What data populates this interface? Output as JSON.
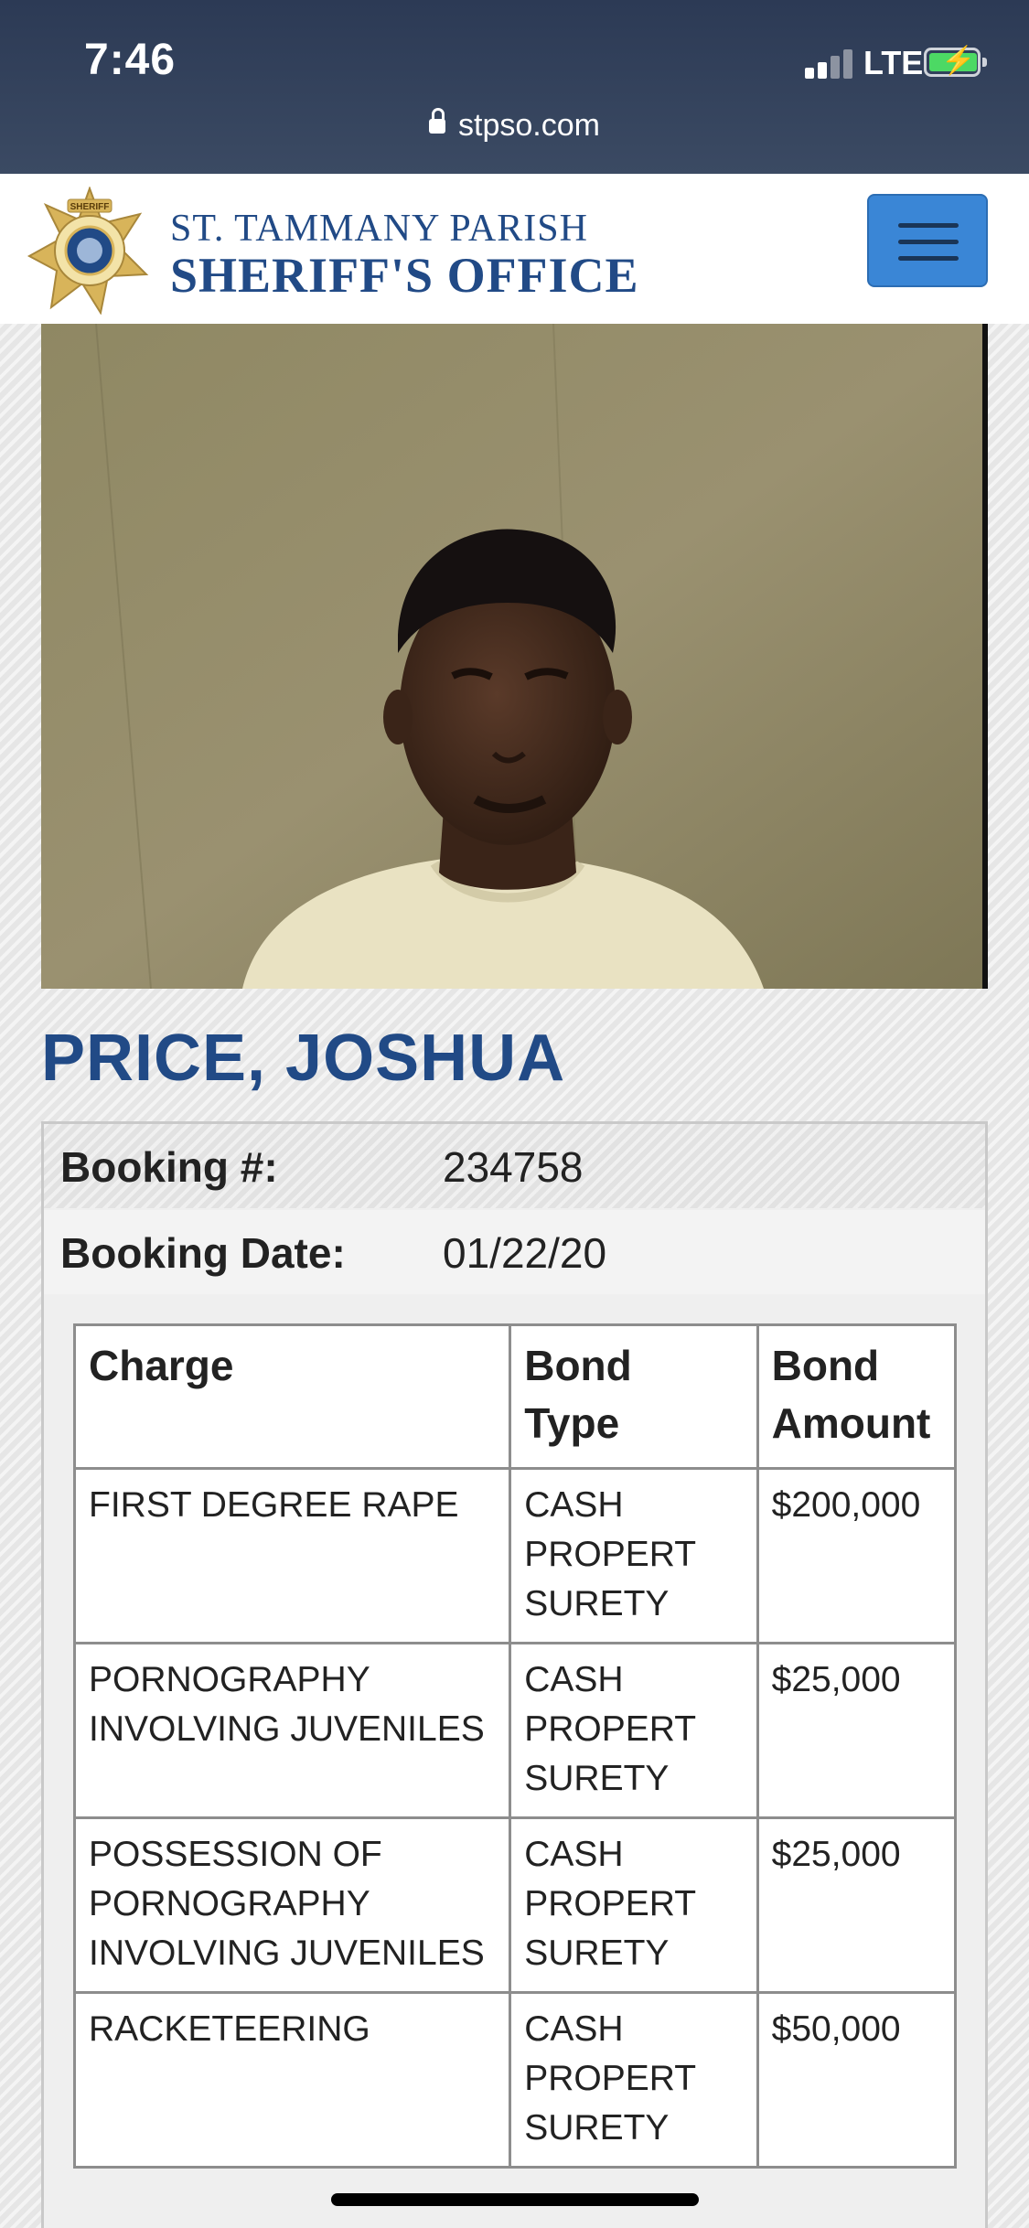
{
  "status_bar": {
    "time": "7:46",
    "network": "LTE",
    "url": "stpso.com"
  },
  "header": {
    "line1": "ST. TAMMANY PARISH",
    "line2": "SHERIFF'S OFFICE",
    "badge_text_top": "SHERIFF",
    "badge_text_ring": "ST. TAMMANY PARISH",
    "badge_text_bottom": "SHERIFF'S OFFICE"
  },
  "inmate": {
    "name": "PRICE, JOSHUA",
    "booking_number_label": "Booking #:",
    "booking_number": "234758",
    "booking_date_label": "Booking Date:",
    "booking_date": "01/22/20"
  },
  "charges_table": {
    "headers": {
      "charge_line1": "Charge",
      "bond_type_line1": "Bond",
      "bond_type_line2": "Type",
      "bond_amount_line1": "Bond",
      "bond_amount_line2": "Amount"
    },
    "rows": [
      {
        "charge": [
          "FIRST DEGREE RAPE"
        ],
        "bond_type": [
          "CASH",
          "PROPERT",
          "SURETY"
        ],
        "bond_amount": "$200,000"
      },
      {
        "charge": [
          "PORNOGRAPHY",
          "INVOLVING JUVENILES"
        ],
        "bond_type": [
          "CASH",
          "PROPERT",
          "SURETY"
        ],
        "bond_amount": "$25,000"
      },
      {
        "charge": [
          "POSSESSION OF",
          "PORNOGRAPHY",
          "INVOLVING JUVENILES"
        ],
        "bond_type": [
          "CASH",
          "PROPERT",
          "SURETY"
        ],
        "bond_amount": "$25,000"
      },
      {
        "charge": [
          "RACKETEERING"
        ],
        "bond_type": [
          "CASH",
          "PROPERT",
          "SURETY"
        ],
        "bond_amount": "$50,000"
      }
    ]
  },
  "colors": {
    "brand_blue": "#214a86",
    "menu_button": "#3a86d6",
    "status_bar": "#2c3a55"
  }
}
